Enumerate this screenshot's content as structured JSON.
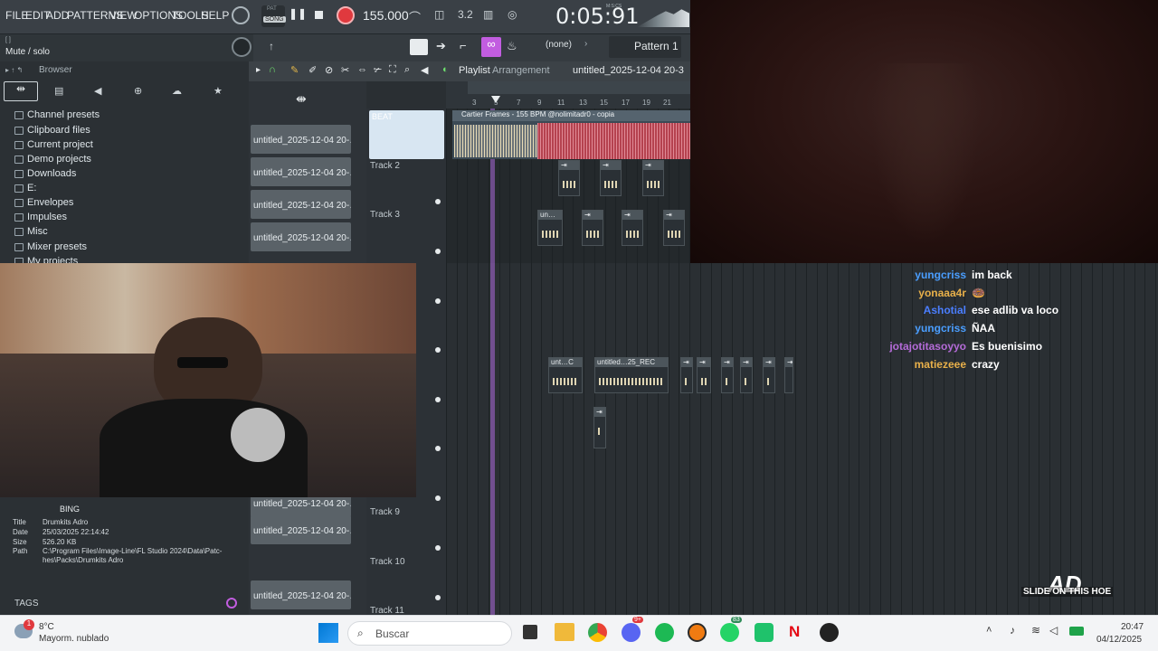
{
  "menu": {
    "items": [
      "FILE",
      "EDIT",
      "ADD",
      "PATTERNS",
      "VIEW",
      "OPTIONS",
      "TOOLS",
      "HELP"
    ]
  },
  "transport": {
    "mode": "SONG",
    "pat_label": "PAT",
    "tempo": "155.000",
    "time": "0:05:91",
    "time_unit": "M:S:CS"
  },
  "hint": {
    "text": "Mute / solo",
    "bracket": "[ ]"
  },
  "toolbar2": {
    "pattern_none": "(none)",
    "pattern": "Pattern 1"
  },
  "browser": {
    "title": "Browser",
    "folders": [
      "Channel presets",
      "Clipboard files",
      "Current project",
      "Demo projects",
      "Downloads",
      "E:",
      "Envelopes",
      "Impulses",
      "Misc",
      "Mixer presets",
      "My projects"
    ]
  },
  "browser_info": {
    "header": "BING",
    "title_label": "Title",
    "title_val": "Drumkits Adro",
    "date_label": "Date",
    "date_val": "25/03/2025 22:14:42",
    "size_label": "Size",
    "size_val": "526.20 KB",
    "path_label": "Path",
    "path_val": "C:\\Program Files\\Image-Line\\FL Studio 2024\\Data\\Patc-hes\\Packs\\Drumkits Adro",
    "tags": "TAGS"
  },
  "channels": {
    "items": [
      "untitled_2025-12-04 20-…",
      "untitled_2025-12-04 20-…",
      "untitled_2025-12-04 20-…",
      "untitled_2025-12-04 20-…",
      "untitled_2025-12-04 20-…",
      "untitled_2025-12-04 20-…",
      "untitled_2025-12-04 20-…"
    ]
  },
  "playlist": {
    "title": "Playlist",
    "subtitle": "Arrangement",
    "project": "untitled_2025-12-04 20-3",
    "ruler": [
      "3",
      "5",
      "7",
      "9",
      "11",
      "13",
      "15",
      "17",
      "19",
      "21"
    ],
    "tracks": [
      {
        "name": "BEAT"
      },
      {
        "name": "Track 2"
      },
      {
        "name": "Track 3"
      },
      {
        "name": "Track 9"
      },
      {
        "name": "Track 10"
      },
      {
        "name": "Track 11"
      }
    ],
    "beat_clip": "Cartier Frames - 155 BPM @nolimitadr0 - copia",
    "clips": {
      "un": "un…",
      "unt": "unt…C",
      "untitled": "untitled…25_REC"
    }
  },
  "chat": [
    {
      "user": "yungcriss",
      "msg": "im back",
      "color": "#4a9eff"
    },
    {
      "user": "yonaaa4r",
      "msg": "🍩",
      "color": "#e8b04a"
    },
    {
      "user": "Ashotial",
      "msg": "ese adlib va loco",
      "color": "#4a7eff"
    },
    {
      "user": "yungcriss",
      "msg": "ÑAA",
      "color": "#4a9eff"
    },
    {
      "user": "jotajotitasoyyo",
      "msg": "Es buenisimo",
      "color": "#b46bd8"
    },
    {
      "user": "matiezeee",
      "msg": "crazy",
      "color": "#e8b04a"
    }
  ],
  "overlay": {
    "logo": "AD",
    "tagline": "SLIDE ON THIS HOE"
  },
  "taskbar": {
    "temp": "8°C",
    "weather": "Mayorm. nublado",
    "weather_badge": "1",
    "search": "Buscar",
    "time": "20:47",
    "date": "04/12/2025",
    "badge_discord": "9+",
    "badge_whatsapp": "83"
  }
}
